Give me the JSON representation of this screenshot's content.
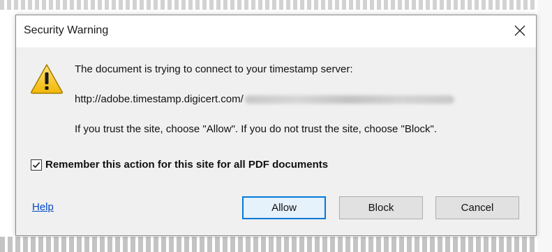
{
  "dialog": {
    "title": "Security Warning",
    "close_icon": "close-icon",
    "warning_icon": "warning-icon",
    "message_line1": "The document is trying to connect to your timestamp server:",
    "server_url": "http://adobe.timestamp.digicert.com/",
    "message_line3": "If you trust the site, choose \"Allow\".  If you do not trust the site, choose \"Block\".",
    "remember_label": "Remember this action for this site for all PDF documents",
    "remember_checked": true,
    "help_label": "Help",
    "buttons": {
      "allow": "Allow",
      "block": "Block",
      "cancel": "Cancel"
    }
  },
  "colors": {
    "dialog_bg": "#f0f0f0",
    "titlebar_bg": "#ffffff",
    "focus_border": "#0078d7",
    "link": "#0047c6",
    "warning_yellow": "#f5c518"
  }
}
